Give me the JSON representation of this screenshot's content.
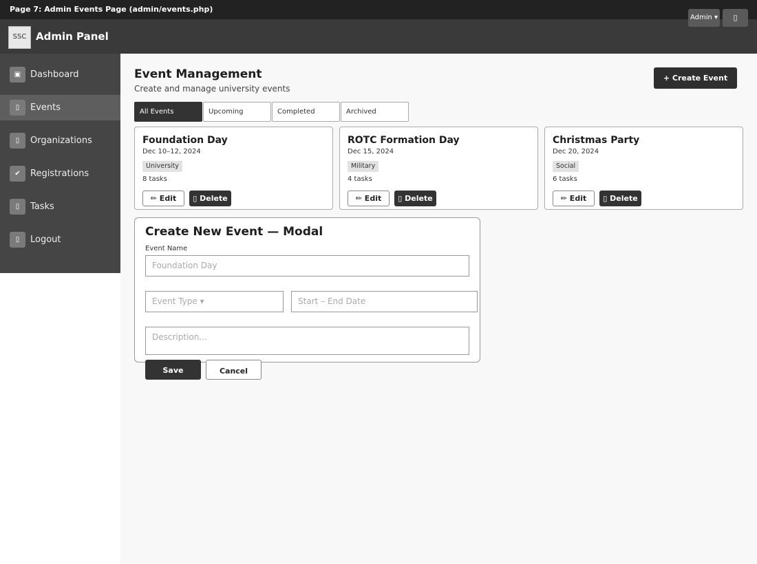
{
  "caption": "Page 7: Admin Events Page (admin/events.php)",
  "header": {
    "logo_text": "SSC",
    "brand": "Admin Panel",
    "admin_menu": "Admin ▾",
    "icon_button": "▯"
  },
  "sidebar": {
    "items": [
      {
        "icon": "▣",
        "label": "Dashboard",
        "active": false
      },
      {
        "icon": "▯",
        "label": "Events",
        "active": true
      },
      {
        "icon": "▯",
        "label": "Organizations",
        "active": false
      },
      {
        "icon": "✔",
        "label": "Registrations",
        "active": false
      },
      {
        "icon": "▯",
        "label": "Tasks",
        "active": false
      },
      {
        "icon": "▯",
        "label": "Logout",
        "active": false
      }
    ]
  },
  "main": {
    "title": "Event Management",
    "subtitle": "Create and manage university events",
    "create_button": "+ Create Event",
    "tabs": [
      {
        "label": "All Events",
        "active": true
      },
      {
        "label": "Upcoming",
        "active": false
      },
      {
        "label": "Completed",
        "active": false
      },
      {
        "label": "Archived",
        "active": false
      }
    ],
    "events": [
      {
        "title": "Foundation Day",
        "date": "Dec 10–12, 2024",
        "tag": "University",
        "tasks": "8 tasks"
      },
      {
        "title": "ROTC Formation Day",
        "date": "Dec 15, 2024",
        "tag": "Military",
        "tasks": "4 tasks"
      },
      {
        "title": "Christmas Party",
        "date": "Dec 20, 2024",
        "tag": "Social",
        "tasks": "6 tasks"
      }
    ],
    "edit_label": "✏ Edit",
    "delete_label": "▯ Delete"
  },
  "modal": {
    "title": "Create New Event — Modal",
    "event_name_label": "Event Name",
    "event_name_placeholder": "Foundation Day",
    "event_type_placeholder": "Event Type ▾",
    "date_placeholder": "Start – End Date",
    "description_placeholder": "Description...",
    "save_label": "Save",
    "cancel_label": "Cancel"
  }
}
